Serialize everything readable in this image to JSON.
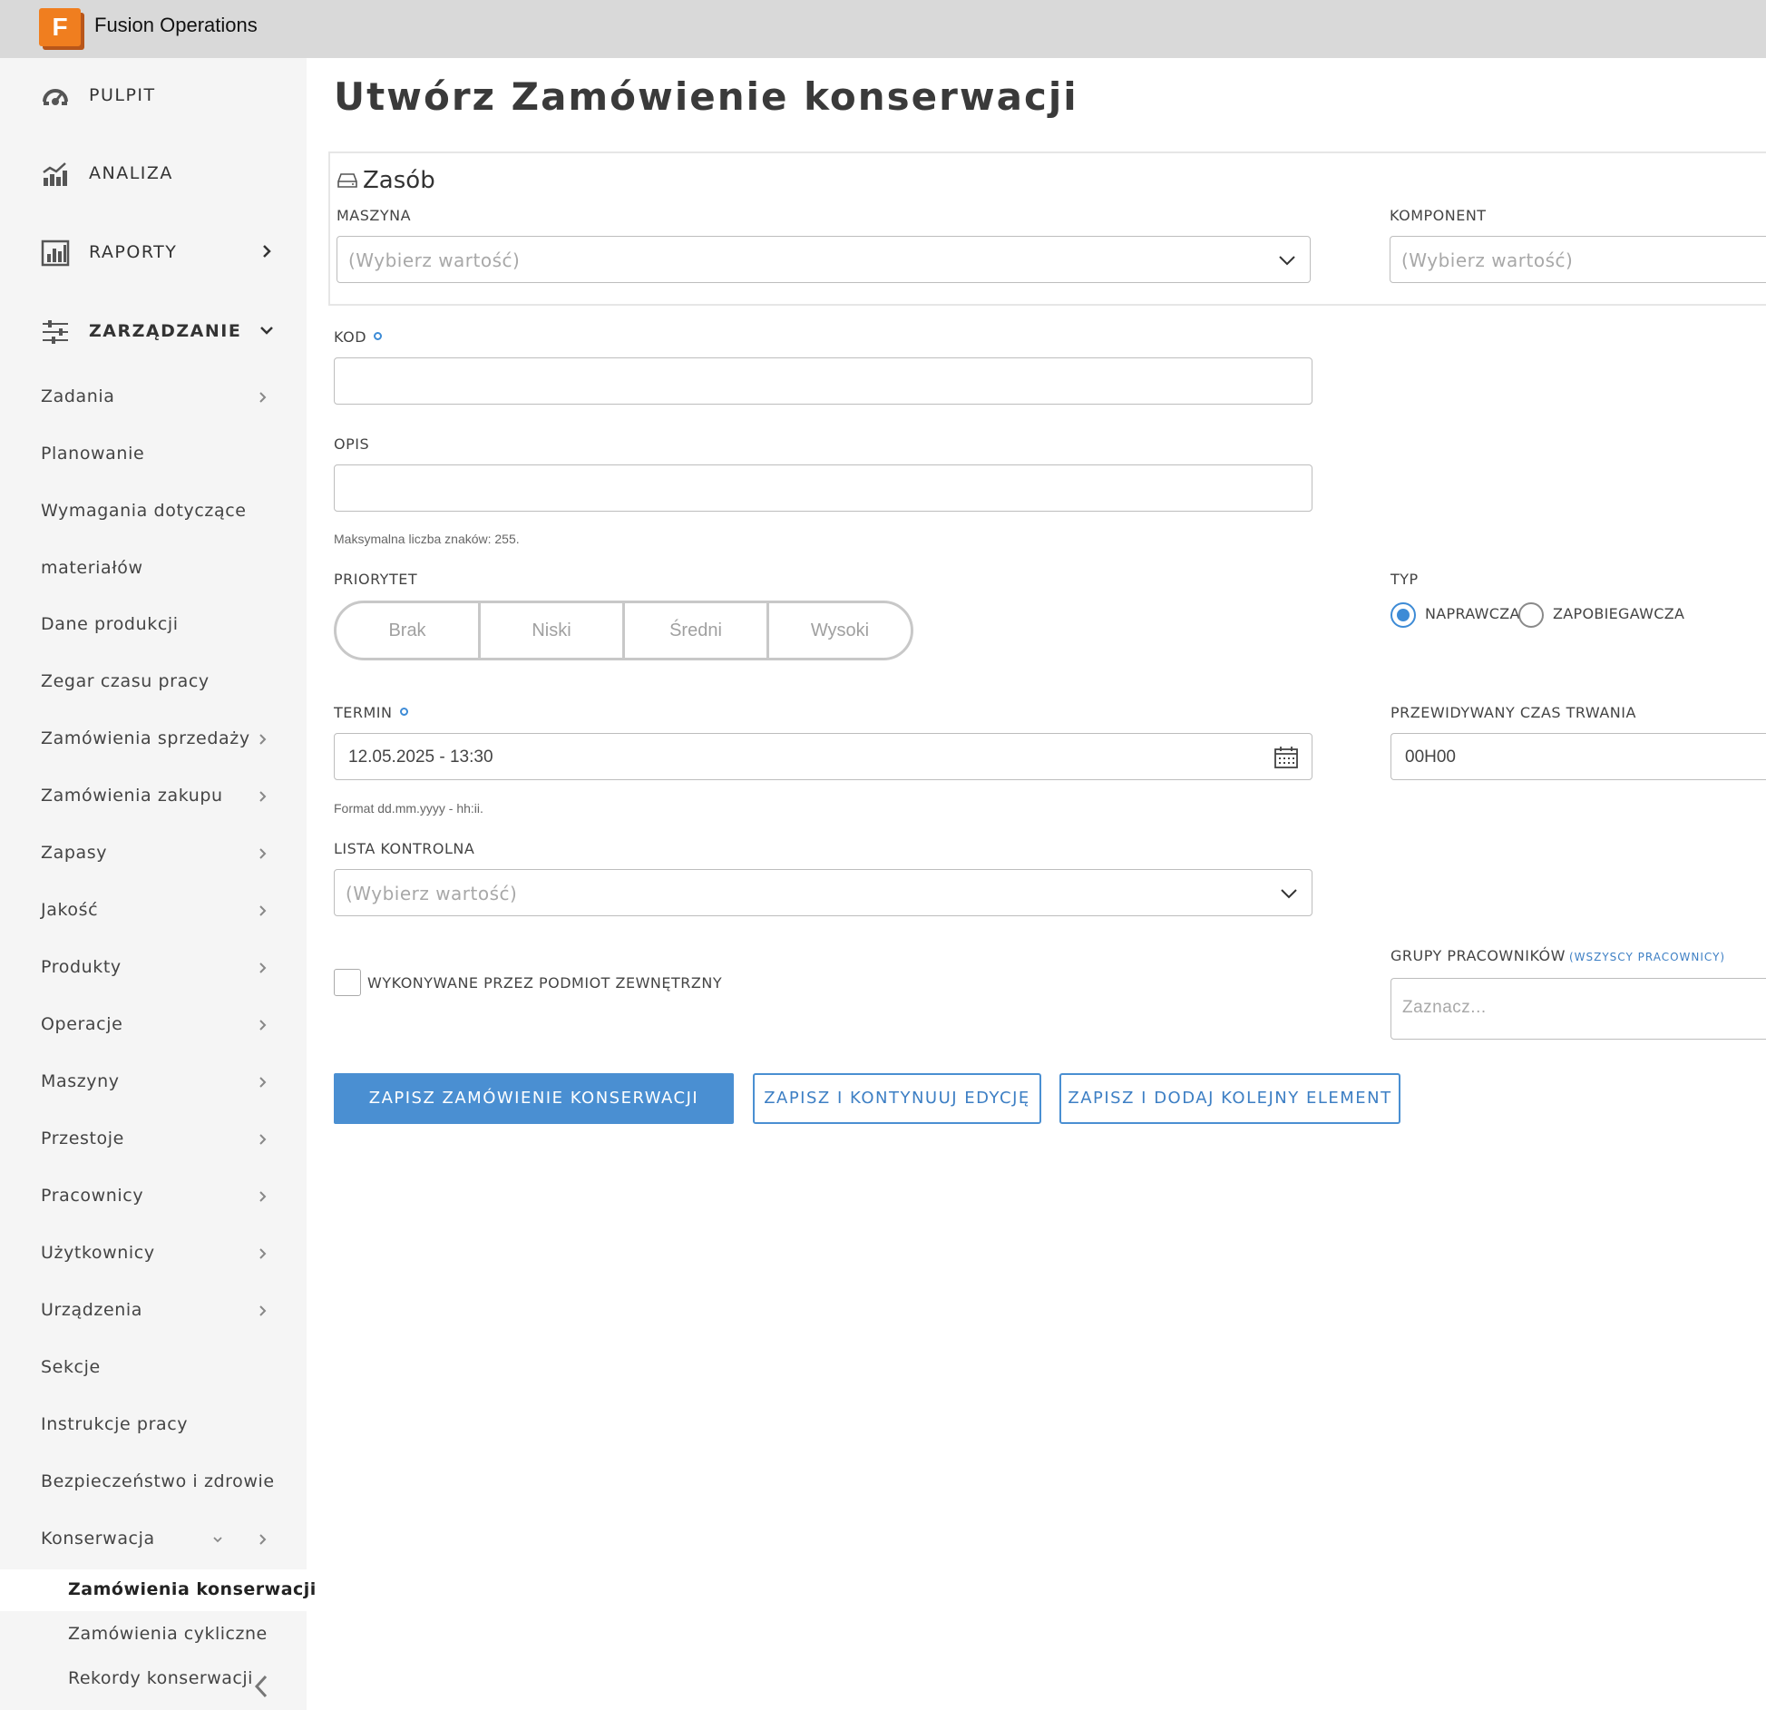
{
  "app": {
    "logo_letter": "F",
    "title": "Fusion Operations"
  },
  "sidebar": {
    "top_items": [
      {
        "label": "PULPIT",
        "icon": "dashboard-gauge-icon"
      },
      {
        "label": "ANALIZA",
        "icon": "analytics-chart-icon"
      },
      {
        "label": "RAPORTY",
        "icon": "reports-chart-icon"
      },
      {
        "label": "ZARZĄDZANIE",
        "icon": "sliders-icon"
      }
    ],
    "sub_items": [
      "Zadania",
      "Planowanie",
      "Wymagania dotyczące",
      "materiałów",
      "Dane produkcji",
      "Zegar czasu pracy",
      "Zamówienia sprzedaży",
      "Zamówienia zakupu",
      "Zapasy",
      "Jakość",
      "Produkty",
      "Operacje",
      "Maszyny",
      "Przestoje",
      "Pracownicy",
      "Użytkownicy",
      "Urządzenia",
      "Sekcje",
      "Instrukcje pracy",
      "Bezpieczeństwo i zdrowie",
      "Konserwacja"
    ],
    "maintenance_items": [
      "Zamówienia konserwacji",
      "Zamówienia cykliczne",
      "Rekordy konserwacji"
    ]
  },
  "page": {
    "title": "Utwórz Zamówienie konserwacji"
  },
  "asset": {
    "title": "Zasób",
    "machine_label": "MASZYNA",
    "machine_placeholder": "(Wybierz wartość)",
    "component_label": "KOMPONENT",
    "component_placeholder": "(Wybierz wartość)"
  },
  "form": {
    "code_label": "KOD",
    "description_label": "OPIS",
    "description_hint": "Maksymalna liczba znaków: 255.",
    "priority_label": "PRIORYTET",
    "priority_options": [
      "Brak",
      "Niski",
      "Średni",
      "Wysoki"
    ],
    "type_label": "TYP",
    "type_options": [
      "NAPRAWCZA",
      "ZAPOBIEGAWCZA"
    ],
    "type_selected": "NAPRAWCZA",
    "due_label": "TERMIN",
    "due_value": "12.05.2025 - 13:30",
    "due_hint": "Format dd.mm.yyyy - hh:ii.",
    "duration_label": "PRZEWIDYWANY CZAS TRWANIA",
    "duration_value": "00H00",
    "checklist_label": "LISTA KONTROLNA",
    "checklist_placeholder": "(Wybierz wartość)",
    "external_label": "WYKONYWANE PRZEZ PODMIOT ZEWNĘTRZNY",
    "external_checked": false,
    "groups_label": "GRUPY PRACOWNIKÓW",
    "groups_link": "(WSZYSCY PRACOWNICY)",
    "groups_placeholder": "Zaznacz..."
  },
  "actions": {
    "save": "ZAPISZ ZAMÓWIENIE KONSERWACJI",
    "save_continue": "ZAPISZ I KONTYNUUJ EDYCJĘ",
    "save_add": "ZAPISZ I DODAJ KOLEJNY ELEMENT"
  },
  "colors": {
    "accent": "#4a8fd2",
    "logo": "#f07e1f",
    "topbar": "#d9d9d9",
    "sidebar": "#f5f5f5"
  }
}
